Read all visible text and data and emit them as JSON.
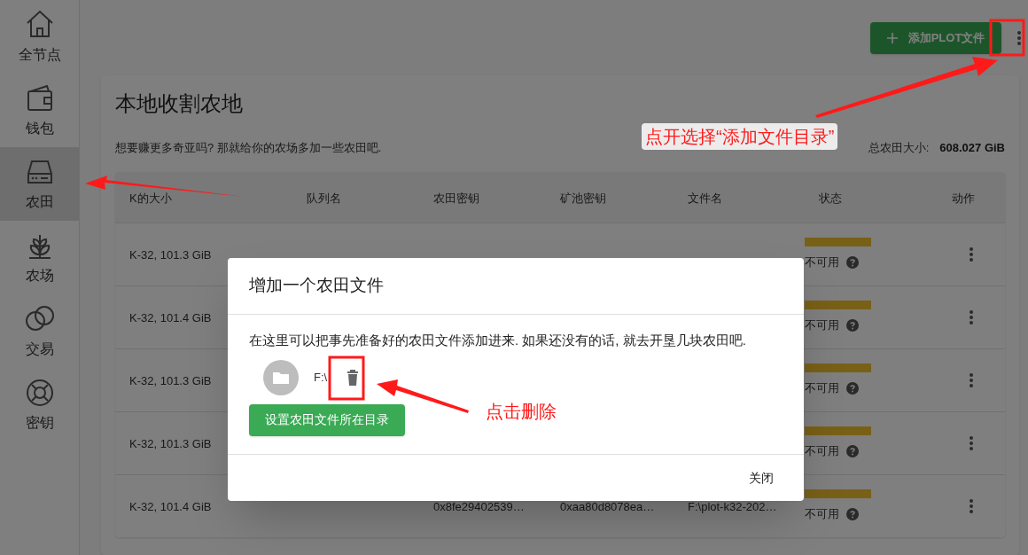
{
  "sidebar": {
    "items": [
      {
        "kind": "home",
        "label": "全节点",
        "selected": false
      },
      {
        "kind": "wallet",
        "label": "钱包",
        "selected": false
      },
      {
        "kind": "plot",
        "label": "农田",
        "selected": true
      },
      {
        "kind": "farm",
        "label": "农场",
        "selected": false
      },
      {
        "kind": "trade",
        "label": "交易",
        "selected": false
      },
      {
        "kind": "keys",
        "label": "密钥",
        "selected": false
      }
    ]
  },
  "toolbar": {
    "add_button": "添加PLOT文件"
  },
  "card": {
    "title": "本地收割农地",
    "subtitle": "想要赚更多奇亚吗? 那就给你的农场多加一些农田吧.",
    "total_label": "总农田大小:",
    "total_value": "608.027 GiB"
  },
  "table": {
    "columns": [
      "K的大小",
      "队列名",
      "农田密钥",
      "矿池密钥",
      "文件名",
      "状态",
      "动作"
    ],
    "rows": [
      {
        "k_size": "K-32, 101.3 GiB",
        "status": "不可用"
      },
      {
        "k_size": "K-32, 101.4 GiB",
        "status": "不可用"
      },
      {
        "k_size": "K-32, 101.3 GiB",
        "status": "不可用"
      },
      {
        "k_size": "K-32, 101.3 GiB",
        "status": "不可用"
      },
      {
        "k_size": "K-32, 101.4 GiB",
        "plot_key": "0x8fe29402539…",
        "pool_key": "0xaa80d8078ea…",
        "filename": "F:\\plot-k32-202…",
        "status": "不可用"
      }
    ]
  },
  "dialog": {
    "title": "增加一个农田文件",
    "description": "在这里可以把事先准备好的农田文件添加进来. 如果还没有的话, 就去开垦几块农田吧.",
    "directories": [
      {
        "path": "F:\\"
      }
    ],
    "set_dir_button": "设置农田文件所在目录",
    "close_button": "关闭"
  },
  "annotation_notes": [
    "点开选择“添加文件目录”",
    "点击删除"
  ]
}
